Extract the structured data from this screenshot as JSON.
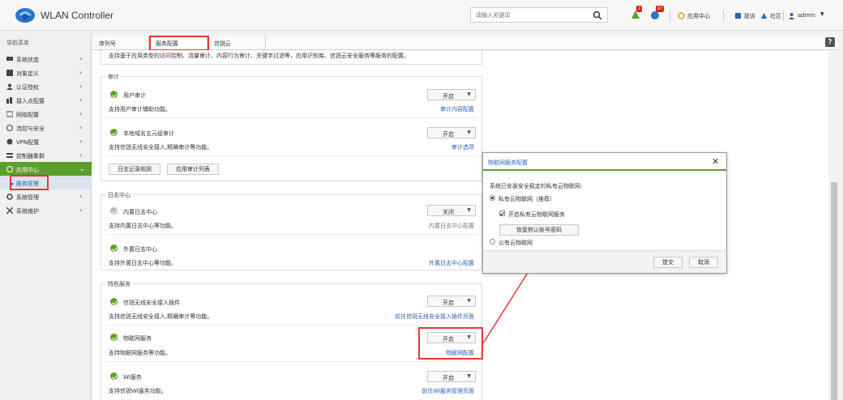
{
  "header": {
    "app_title": "WLAN Controller",
    "search_placeholder": "请输入关键词",
    "badge_alerts": "2",
    "badge_messages": "67",
    "app_center": "应用中心",
    "pending": "投诉",
    "community": "社区",
    "user": "admin",
    "accent_color": "#5aa12b"
  },
  "sidebar": {
    "title": "导航菜单",
    "items": [
      {
        "label": "系统状态",
        "icon": "monitor-icon"
      },
      {
        "label": "对象定义",
        "icon": "object-icon"
      },
      {
        "label": "认证授权",
        "icon": "user-icon"
      },
      {
        "label": "接入点配置",
        "icon": "ap-icon"
      },
      {
        "label": "网络配置",
        "icon": "network-icon"
      },
      {
        "label": "流控与安全",
        "icon": "shield-icon"
      },
      {
        "label": "VPN配置",
        "icon": "vpn-icon"
      },
      {
        "label": "控制器集群",
        "icon": "cluster-icon"
      },
      {
        "label": "应用中心",
        "icon": "app-center-icon"
      },
      {
        "label": "系统管理",
        "icon": "gear-icon"
      },
      {
        "label": "系统维护",
        "icon": "tools-icon"
      }
    ],
    "sub_item": "服务管理"
  },
  "tabs": [
    {
      "label": "序列号"
    },
    {
      "label": "服务配置"
    },
    {
      "label": "信锐云"
    }
  ],
  "content": {
    "top_note": "支持基于应用类型的访问控制、流量审计、内容行为审计、关键字过滤等，应用识别库、信锐云安全服务等服务的配置。",
    "audit_legend": "审计",
    "audit_rows": [
      {
        "title": "用户审计",
        "desc": "支持用户审计辅助功能。",
        "state": "开启",
        "link": "审计内容配置"
      },
      {
        "title": "本地域名五元组审计",
        "desc": "支持信锐无线安全接入,精确审计等功能。",
        "state": "开启",
        "link": "审计选项"
      }
    ],
    "audit_buttons": [
      "日志记录规则",
      "应用审计列表"
    ],
    "log_legend": "日志中心",
    "log_rows": [
      {
        "title": "内置日志中心",
        "desc": "支持内置日志中心等功能。",
        "state": "关闭",
        "link": "内置日志中心配置"
      },
      {
        "title": "外置日志中心",
        "desc": "支持外置日志中心等功能。",
        "state": "",
        "link": "外置日志中心配置"
      }
    ],
    "feature_legend": "特色服务",
    "feature_rows": [
      {
        "title": "信锐无线安全接入插件",
        "desc": "支持信锐无线安全接入,精确审计等功能。",
        "state": "开启",
        "link": "前往信锐无线安全接入插件页面"
      },
      {
        "title": "物联网服务",
        "desc": "支持物联网服务等功能。",
        "state": "开启",
        "link": "物联网配置"
      },
      {
        "title": "Wi服务",
        "desc": "支持信锐Wi服务功能。",
        "state": "开启",
        "link": "前往Wi服务管理页面"
      }
    ]
  },
  "dialog": {
    "title": "物联网服务配置",
    "prompt": "系统已安装安全稳定的私有云物联网:",
    "option_private": "私有云物联网（推荐）",
    "option_private_check": "开启私有云物联网服务",
    "reset_button": "恢复默认账号密码",
    "option_public": "公有云物联网",
    "ok": "提交",
    "cancel": "取消"
  },
  "highlight_color": "#e53935"
}
